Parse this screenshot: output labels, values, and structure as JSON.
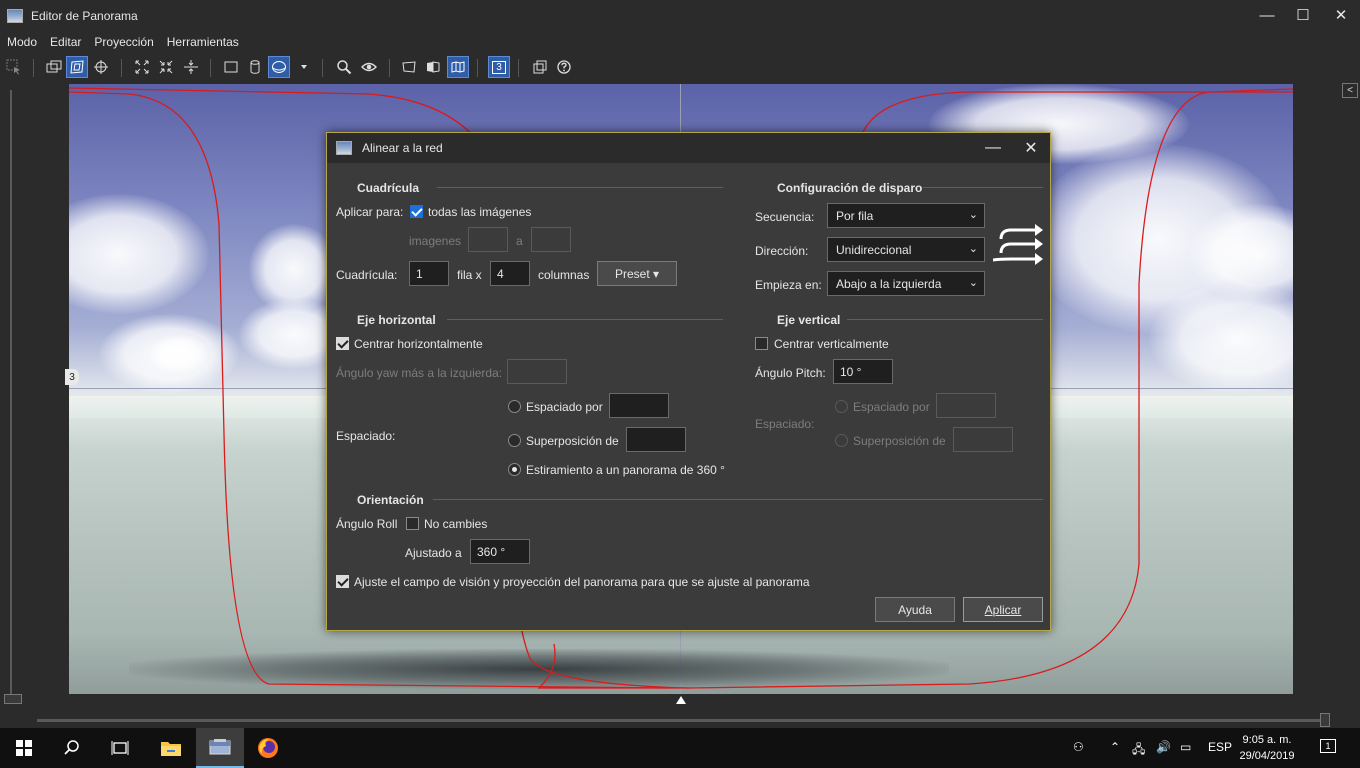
{
  "window": {
    "title": "Editor de Panorama",
    "controls": {
      "minimize": "—",
      "maximize": "☐",
      "close": "✕"
    }
  },
  "menu": [
    "Modo",
    "Editar",
    "Proyección",
    "Herramientas"
  ],
  "toolbar": {
    "icons": [
      "select-icon",
      "preview-icon",
      "layout-icon",
      "crosshair-icon",
      "fit-icon",
      "shrink-icon",
      "center-icon",
      "rectilinear-icon",
      "cylindrical-icon",
      "equirect-icon",
      "dropdown-icon",
      "zoom-icon",
      "eye-icon",
      "perspective-icon",
      "mosaic-icon",
      "map-icon",
      "numbers-icon",
      "overlap-icon",
      "help-icon"
    ],
    "numbers_label": "3"
  },
  "workspace": {
    "row_number_tab": "3",
    "collapse_button": "<"
  },
  "dialog": {
    "title": "Alinear a la red",
    "minimize": "—",
    "close": "✕",
    "grid": {
      "title": "Cuadrícula",
      "apply_label": "Aplicar para:",
      "all_images_label": "todas las imágenes",
      "all_images_checked": true,
      "images_label": "imagenes",
      "range_from": "",
      "range_sep": "a",
      "range_to": "",
      "grid_label": "Cuadrícula:",
      "rows": "1",
      "rows_suffix": "fila x",
      "cols": "4",
      "cols_suffix": "columnas",
      "preset_label": "Preset ▾"
    },
    "shot_config": {
      "title": "Configuración de disparo",
      "sequence_label": "Secuencia:",
      "sequence_value": "Por fila",
      "direction_label": "Dirección:",
      "direction_value": "Unidireccional",
      "start_label": "Empieza en:",
      "start_value": "Abajo a la izquierda"
    },
    "horizontal": {
      "title": "Eje horizontal",
      "center_label": "Centrar horizontalmente",
      "center_checked": true,
      "yaw_label": "Ángulo yaw más a la izquierda:",
      "yaw_value": "",
      "spacing_label": "Espaciado:",
      "spaced_by_label": "Espaciado por",
      "spaced_by_value": "",
      "overlap_label": "Superposición de",
      "overlap_value": "",
      "stretch_label": "Estiramiento a un panorama de 360 °",
      "selected_option": "stretch"
    },
    "vertical": {
      "title": "Eje vertical",
      "center_label": "Centrar verticalmente",
      "center_checked": false,
      "pitch_label": "Ángulo Pitch:",
      "pitch_value": "10 °",
      "spacing_label": "Espaciado:",
      "spaced_by_label": "Espaciado por",
      "spaced_by_value": "",
      "overlap_label": "Superposición de",
      "overlap_value": ""
    },
    "orientation": {
      "title": "Orientación",
      "roll_label": "Ángulo Roll",
      "no_change_label": "No cambies",
      "no_change_checked": false,
      "adjusted_label": "Ajustado a",
      "adjusted_value": "360 °",
      "fit_label": "Ajuste el campo de visión y proyección del panorama para que se ajuste al panorama",
      "fit_checked": true
    },
    "buttons": {
      "help": "Ayuda",
      "apply": "Aplicar"
    }
  },
  "taskbar": {
    "apps": [
      "windows-start-icon",
      "search-icon",
      "task-view-icon",
      "file-explorer-icon",
      "panorama-editor-icon",
      "firefox-icon"
    ],
    "language": "ESP",
    "time": "9:05 a. m.",
    "date": "29/04/2019",
    "notifications": "1"
  },
  "colors": {
    "accent": "#2f5da8",
    "dialog_border": "#b5a64a",
    "path_red": "#d81c1c"
  }
}
